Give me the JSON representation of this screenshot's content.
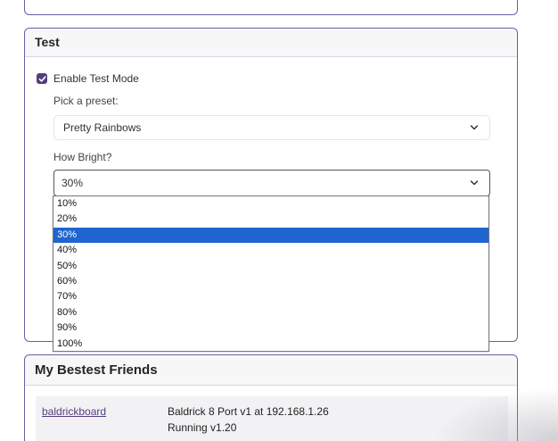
{
  "test_card": {
    "title": "Test",
    "enable_test_mode_label": "Enable Test Mode",
    "enable_test_mode_checked": true,
    "preset_label": "Pick a preset:",
    "preset_value": "Pretty Rainbows",
    "brightness_label": "How Bright?",
    "brightness_value": "30%",
    "brightness_options": [
      "10%",
      "20%",
      "30%",
      "40%",
      "50%",
      "60%",
      "70%",
      "80%",
      "90%",
      "100%"
    ],
    "brightness_selected_index": 2
  },
  "friends_card": {
    "title": "My Bestest Friends",
    "rows": [
      {
        "name": "baldrickboard",
        "description": "Baldrick 8 Port v1 at 192.168.1.26",
        "status": "Running v1.20"
      }
    ]
  },
  "colors": {
    "accent": "#563d7c",
    "card_border": "#6a5fa3",
    "selection": "#1f64cf"
  }
}
